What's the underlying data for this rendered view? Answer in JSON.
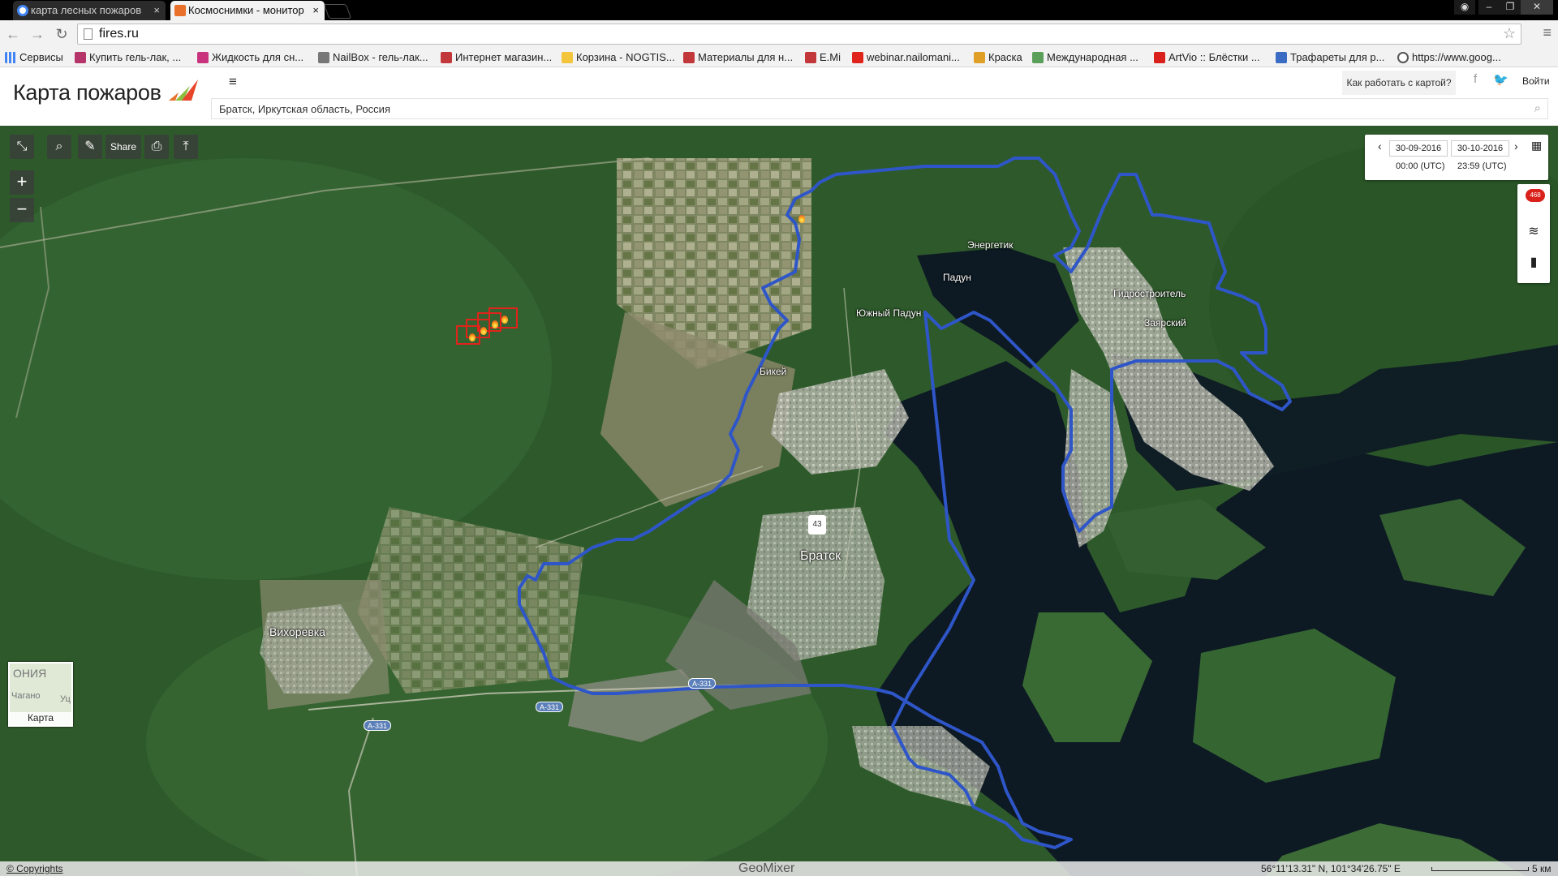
{
  "browser": {
    "tabs": [
      {
        "title": "карта лесных пожаров",
        "close": "×"
      },
      {
        "title": "Космоснимки - монитор",
        "close": "×"
      }
    ],
    "url": "fires.ru",
    "bookmarks": [
      "Сервисы",
      "Купить гель-лак, ...",
      "Жидкость для сн...",
      "NailBox - гель-лак...",
      "Интернет магазин...",
      "Корзина - NOGTIS...",
      "Материалы для н...",
      "E.Mi",
      "webinar.nailomani...",
      "Краска",
      "Международная ...",
      "ArtVio :: Блёстки ...",
      "Трафареты для р...",
      "https://www.goog..."
    ]
  },
  "site": {
    "logo": "Карта пожаров",
    "help_label": "Как работать с картой?",
    "login_label": "Войти",
    "search_value": "Братск, Иркутская область, Россия"
  },
  "toolbar": {
    "share_label": "Share",
    "zoom_in": "+",
    "zoom_out": "−"
  },
  "dates": {
    "from": "30-09-2016",
    "to": "30-10-2016",
    "from_time": "00:00 (UTC)",
    "to_time": "23:59 (UTC)"
  },
  "fire_count": "468",
  "map_labels": {
    "bratsk": "Братск",
    "vikhorevka": "Вихоревка",
    "energetik": "Энергетик",
    "padun": "Падун",
    "yuzhny_padun": "Южный Падун",
    "bikey": "Бикей",
    "gidrostroitel": "Гидростроитель",
    "zayarsky": "Заярский",
    "bratsk_badge": "43",
    "road1": "А-331",
    "road2": "А-331",
    "road3": "А-331"
  },
  "basemap": {
    "label": "Карта",
    "mini1": "ОНИЯ",
    "mini2": "Чагано",
    "mini3": "Уц"
  },
  "footer": {
    "copyrights": "© Copyrights",
    "brand": "GeoMixer",
    "coords": "56°11'13.31\" N, 101°34'26.75\" E",
    "scale": "5 км"
  },
  "colors": {
    "boundary": "#2f56c8",
    "water": "#0d1a23",
    "forest": "#2f5a2c",
    "fire_box": "#e0241c"
  }
}
